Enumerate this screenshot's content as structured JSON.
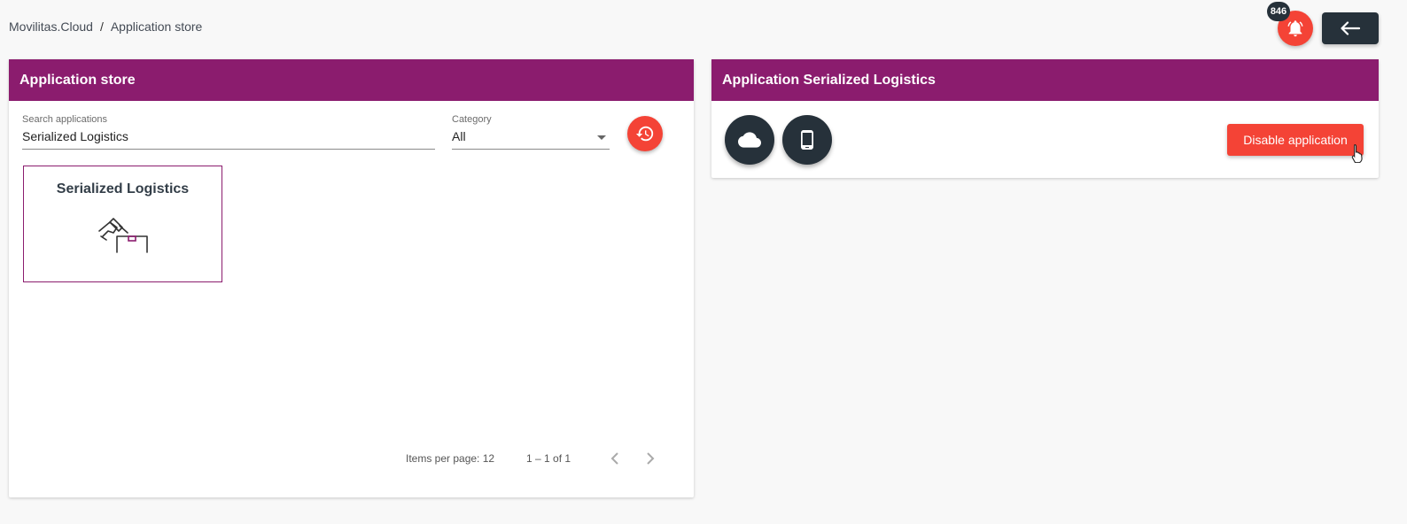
{
  "breadcrumb": {
    "root": "Movilitas.Cloud",
    "separator": "/",
    "current": "Application store"
  },
  "notifications": {
    "count": "846",
    "icon": "bell-icon"
  },
  "back": {
    "icon": "arrow-left-icon"
  },
  "store": {
    "title": "Application store",
    "search": {
      "label": "Search applications",
      "value": "Serialized Logistics"
    },
    "category": {
      "label": "Category",
      "value": "All"
    },
    "reset_icon": "history-icon",
    "apps": [
      {
        "title": "Serialized Logistics",
        "icon": "scanner-box-icon"
      }
    ],
    "paginator": {
      "items_per_page": "Items per page: 12",
      "range": "1 – 1 of 1"
    }
  },
  "detail": {
    "title": "Application Serialized Logistics",
    "cloud_icon": "cloud-icon",
    "mobile_icon": "mobile-icon",
    "disable_label": "Disable application"
  },
  "colors": {
    "header": "#8b1c6e",
    "accent": "#f44336",
    "dark": "#26313a"
  }
}
